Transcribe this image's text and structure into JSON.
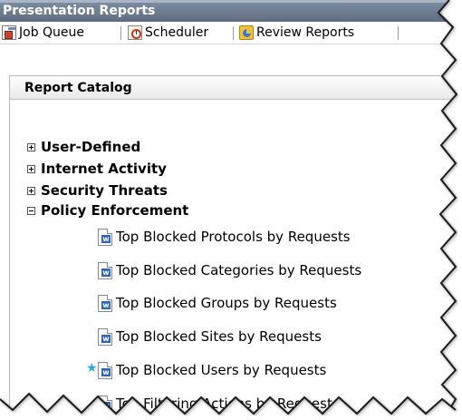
{
  "window": {
    "title": "Presentation Reports"
  },
  "toolbar": {
    "items": [
      {
        "label": "Job Queue",
        "icon": "job-queue-icon"
      },
      {
        "label": "Scheduler",
        "icon": "scheduler-icon"
      },
      {
        "label": "Review Reports",
        "icon": "review-reports-icon"
      }
    ]
  },
  "catalog": {
    "title": "Report Catalog",
    "categories": [
      {
        "label": "User-Defined",
        "expanded": false
      },
      {
        "label": "Internet Activity",
        "expanded": false
      },
      {
        "label": "Security Threats",
        "expanded": false
      },
      {
        "label": "Policy Enforcement",
        "expanded": true
      }
    ],
    "reports": [
      {
        "label": "Top Blocked Protocols by Requests",
        "starred": false
      },
      {
        "label": "Top Blocked Categories by Requests",
        "starred": false
      },
      {
        "label": "Top Blocked Groups by Requests",
        "starred": false
      },
      {
        "label": "Top Blocked Sites by Requests",
        "starred": false
      },
      {
        "label": "Top Blocked Users by Requests",
        "starred": true
      },
      {
        "label": "Top Filtering Actions by Requests",
        "starred": false
      }
    ]
  },
  "colors": {
    "title_bar": "#6b7a8e",
    "star": "#2aa6e0",
    "doc_icon": "#2c64b8"
  }
}
